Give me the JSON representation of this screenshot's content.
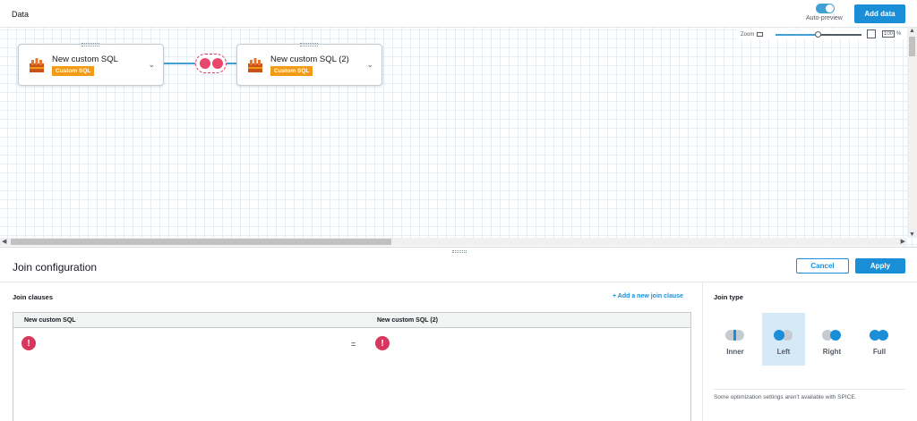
{
  "header": {
    "title": "Data",
    "auto_preview_label": "Auto-preview",
    "add_data_label": "Add data"
  },
  "canvas": {
    "zoom": {
      "label": "Zoom",
      "value": "100",
      "unit": "%"
    },
    "nodes": [
      {
        "title": "New custom SQL",
        "tag": "Custom SQL"
      },
      {
        "title": "New custom SQL (2)",
        "tag": "Custom SQL"
      }
    ]
  },
  "join_config": {
    "title": "Join configuration",
    "cancel_label": "Cancel",
    "apply_label": "Apply",
    "clauses": {
      "title": "Join clauses",
      "add_label": "+ Add a new join clause",
      "left_header": "New custom SQL",
      "right_header": "New custom SQL (2)",
      "equals": "=",
      "error_glyph": "!"
    },
    "join_type": {
      "title": "Join type",
      "options": [
        {
          "label": "Inner",
          "selected": false
        },
        {
          "label": "Left",
          "selected": true
        },
        {
          "label": "Right",
          "selected": false
        },
        {
          "label": "Full",
          "selected": false
        }
      ],
      "note": "Some optimization settings aren't available with SPICE."
    }
  },
  "colors": {
    "accent": "#1a8fd8",
    "tag_orange": "#f39a17",
    "error_red": "#d9365f",
    "selected_bg": "#d6e9f7"
  },
  "icons": {
    "db": "amazon-redshift-icon",
    "error": "exclamation-circle-icon",
    "chevron": "chevron-down-icon"
  }
}
